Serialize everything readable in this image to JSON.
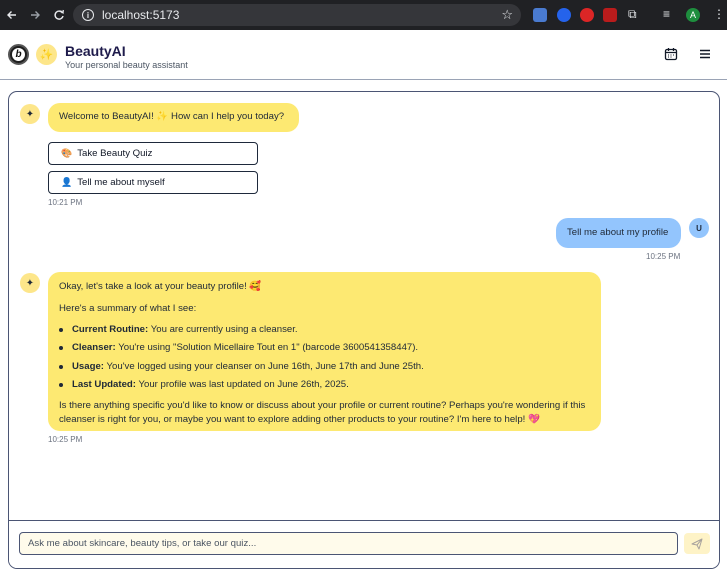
{
  "browser": {
    "url": "localhost:5173",
    "profile_initial": "A"
  },
  "header": {
    "title": "BeautyAI",
    "subtitle": "Your personal beauty assistant",
    "logo_letter": "b"
  },
  "messages": {
    "welcome": {
      "text": "Welcome to BeautyAI! ✨ How can I help you today?",
      "time": "10:21 PM"
    },
    "quick_actions": [
      {
        "emoji": "🎨",
        "label": "Take Beauty Quiz"
      },
      {
        "emoji": "👤",
        "label": "Tell me about myself"
      }
    ],
    "user": {
      "text": "Tell me about my profile",
      "time": "10:25 PM",
      "avatar": "U"
    },
    "profile_reply": {
      "intro": "Okay, let's take a look at your beauty profile! 🥰",
      "summary": "Here's a summary of what I see:",
      "items": [
        {
          "label": "Current Routine:",
          "text": "You are currently using a cleanser."
        },
        {
          "label": "Cleanser:",
          "text": "You're using \"Solution Micellaire Tout en 1\" (barcode 3600541358447)."
        },
        {
          "label": "Usage:",
          "text": "You've logged using your cleanser on June 16th, June 17th and June 25th."
        },
        {
          "label": "Last Updated:",
          "text": "Your profile was last updated on June 26th, 2025."
        }
      ],
      "closing": "Is there anything specific you'd like to know or discuss about your profile or current routine? Perhaps you're wondering if this cleanser is right for you, or maybe you want to explore adding other products to your routine? I'm here to help! 💖",
      "time": "10:25 PM"
    }
  },
  "input": {
    "placeholder": "Ask me about skincare, beauty tips, or take our quiz..."
  },
  "colors": {
    "bot_bubble": "#fde972",
    "user_bubble": "#93c5fd",
    "accent": "#fde68a"
  }
}
